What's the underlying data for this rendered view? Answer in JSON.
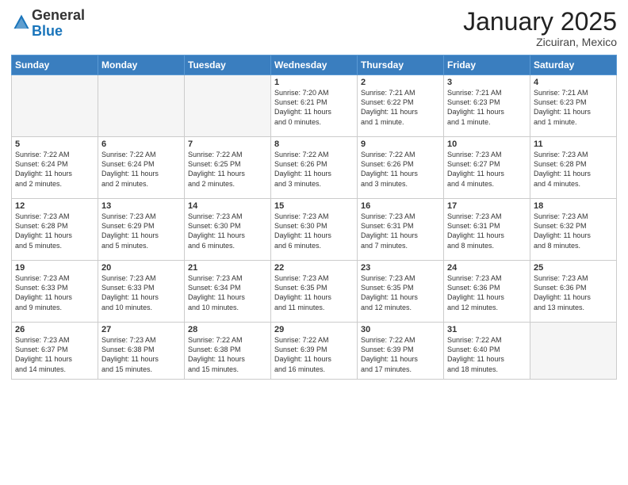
{
  "header": {
    "logo_general": "General",
    "logo_blue": "Blue",
    "month_title": "January 2025",
    "location": "Zicuiran, Mexico"
  },
  "weekdays": [
    "Sunday",
    "Monday",
    "Tuesday",
    "Wednesday",
    "Thursday",
    "Friday",
    "Saturday"
  ],
  "weeks": [
    [
      {
        "day": "",
        "info": ""
      },
      {
        "day": "",
        "info": ""
      },
      {
        "day": "",
        "info": ""
      },
      {
        "day": "1",
        "info": "Sunrise: 7:20 AM\nSunset: 6:21 PM\nDaylight: 11 hours\nand 0 minutes."
      },
      {
        "day": "2",
        "info": "Sunrise: 7:21 AM\nSunset: 6:22 PM\nDaylight: 11 hours\nand 1 minute."
      },
      {
        "day": "3",
        "info": "Sunrise: 7:21 AM\nSunset: 6:23 PM\nDaylight: 11 hours\nand 1 minute."
      },
      {
        "day": "4",
        "info": "Sunrise: 7:21 AM\nSunset: 6:23 PM\nDaylight: 11 hours\nand 1 minute."
      }
    ],
    [
      {
        "day": "5",
        "info": "Sunrise: 7:22 AM\nSunset: 6:24 PM\nDaylight: 11 hours\nand 2 minutes."
      },
      {
        "day": "6",
        "info": "Sunrise: 7:22 AM\nSunset: 6:24 PM\nDaylight: 11 hours\nand 2 minutes."
      },
      {
        "day": "7",
        "info": "Sunrise: 7:22 AM\nSunset: 6:25 PM\nDaylight: 11 hours\nand 2 minutes."
      },
      {
        "day": "8",
        "info": "Sunrise: 7:22 AM\nSunset: 6:26 PM\nDaylight: 11 hours\nand 3 minutes."
      },
      {
        "day": "9",
        "info": "Sunrise: 7:22 AM\nSunset: 6:26 PM\nDaylight: 11 hours\nand 3 minutes."
      },
      {
        "day": "10",
        "info": "Sunrise: 7:23 AM\nSunset: 6:27 PM\nDaylight: 11 hours\nand 4 minutes."
      },
      {
        "day": "11",
        "info": "Sunrise: 7:23 AM\nSunset: 6:28 PM\nDaylight: 11 hours\nand 4 minutes."
      }
    ],
    [
      {
        "day": "12",
        "info": "Sunrise: 7:23 AM\nSunset: 6:28 PM\nDaylight: 11 hours\nand 5 minutes."
      },
      {
        "day": "13",
        "info": "Sunrise: 7:23 AM\nSunset: 6:29 PM\nDaylight: 11 hours\nand 5 minutes."
      },
      {
        "day": "14",
        "info": "Sunrise: 7:23 AM\nSunset: 6:30 PM\nDaylight: 11 hours\nand 6 minutes."
      },
      {
        "day": "15",
        "info": "Sunrise: 7:23 AM\nSunset: 6:30 PM\nDaylight: 11 hours\nand 6 minutes."
      },
      {
        "day": "16",
        "info": "Sunrise: 7:23 AM\nSunset: 6:31 PM\nDaylight: 11 hours\nand 7 minutes."
      },
      {
        "day": "17",
        "info": "Sunrise: 7:23 AM\nSunset: 6:31 PM\nDaylight: 11 hours\nand 8 minutes."
      },
      {
        "day": "18",
        "info": "Sunrise: 7:23 AM\nSunset: 6:32 PM\nDaylight: 11 hours\nand 8 minutes."
      }
    ],
    [
      {
        "day": "19",
        "info": "Sunrise: 7:23 AM\nSunset: 6:33 PM\nDaylight: 11 hours\nand 9 minutes."
      },
      {
        "day": "20",
        "info": "Sunrise: 7:23 AM\nSunset: 6:33 PM\nDaylight: 11 hours\nand 10 minutes."
      },
      {
        "day": "21",
        "info": "Sunrise: 7:23 AM\nSunset: 6:34 PM\nDaylight: 11 hours\nand 10 minutes."
      },
      {
        "day": "22",
        "info": "Sunrise: 7:23 AM\nSunset: 6:35 PM\nDaylight: 11 hours\nand 11 minutes."
      },
      {
        "day": "23",
        "info": "Sunrise: 7:23 AM\nSunset: 6:35 PM\nDaylight: 11 hours\nand 12 minutes."
      },
      {
        "day": "24",
        "info": "Sunrise: 7:23 AM\nSunset: 6:36 PM\nDaylight: 11 hours\nand 12 minutes."
      },
      {
        "day": "25",
        "info": "Sunrise: 7:23 AM\nSunset: 6:36 PM\nDaylight: 11 hours\nand 13 minutes."
      }
    ],
    [
      {
        "day": "26",
        "info": "Sunrise: 7:23 AM\nSunset: 6:37 PM\nDaylight: 11 hours\nand 14 minutes."
      },
      {
        "day": "27",
        "info": "Sunrise: 7:23 AM\nSunset: 6:38 PM\nDaylight: 11 hours\nand 15 minutes."
      },
      {
        "day": "28",
        "info": "Sunrise: 7:22 AM\nSunset: 6:38 PM\nDaylight: 11 hours\nand 15 minutes."
      },
      {
        "day": "29",
        "info": "Sunrise: 7:22 AM\nSunset: 6:39 PM\nDaylight: 11 hours\nand 16 minutes."
      },
      {
        "day": "30",
        "info": "Sunrise: 7:22 AM\nSunset: 6:39 PM\nDaylight: 11 hours\nand 17 minutes."
      },
      {
        "day": "31",
        "info": "Sunrise: 7:22 AM\nSunset: 6:40 PM\nDaylight: 11 hours\nand 18 minutes."
      },
      {
        "day": "",
        "info": ""
      }
    ]
  ]
}
